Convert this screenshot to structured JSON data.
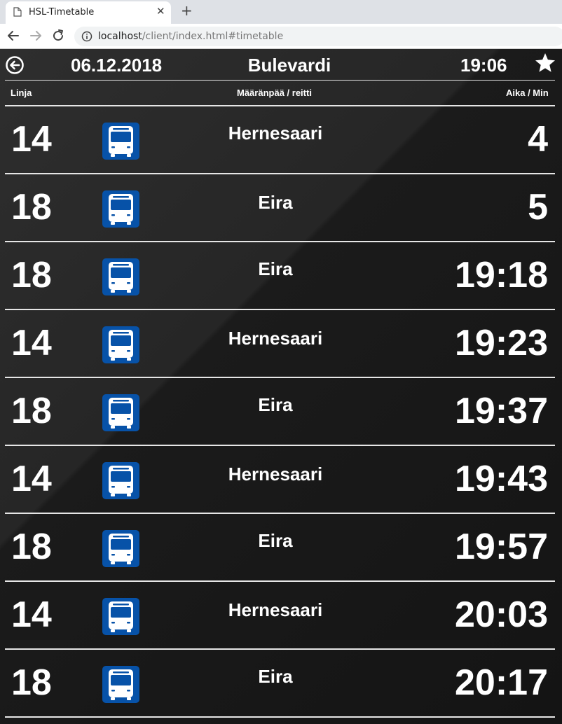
{
  "browser": {
    "tab_title": "HSL-Timetable",
    "tab_close": "✕",
    "new_tab": "+",
    "url_host": "localhost",
    "url_path": "/client/index.html#timetable"
  },
  "header": {
    "date": "06.12.2018",
    "stop_name": "Bulevardi",
    "time": "19:06"
  },
  "columns": {
    "line": "Linja",
    "destination": "Määränpää / reitti",
    "time": "Aika / Min"
  },
  "departures": [
    {
      "line": "14",
      "destination": "Hernesaari",
      "eta": "4"
    },
    {
      "line": "18",
      "destination": "Eira",
      "eta": "5"
    },
    {
      "line": "18",
      "destination": "Eira",
      "eta": "19:18"
    },
    {
      "line": "14",
      "destination": "Hernesaari",
      "eta": "19:23"
    },
    {
      "line": "18",
      "destination": "Eira",
      "eta": "19:37"
    },
    {
      "line": "14",
      "destination": "Hernesaari",
      "eta": "19:43"
    },
    {
      "line": "18",
      "destination": "Eira",
      "eta": "19:57"
    },
    {
      "line": "14",
      "destination": "Hernesaari",
      "eta": "20:03"
    },
    {
      "line": "18",
      "destination": "Eira",
      "eta": "20:17"
    }
  ],
  "icons": {
    "mode": "bus-icon",
    "back": "back-arrow-icon",
    "favorite": "star-icon"
  },
  "colors": {
    "bus_tile": "#0752a8",
    "bus_body": "#ffffff",
    "background": "#1a1a1a",
    "text": "#ffffff"
  }
}
